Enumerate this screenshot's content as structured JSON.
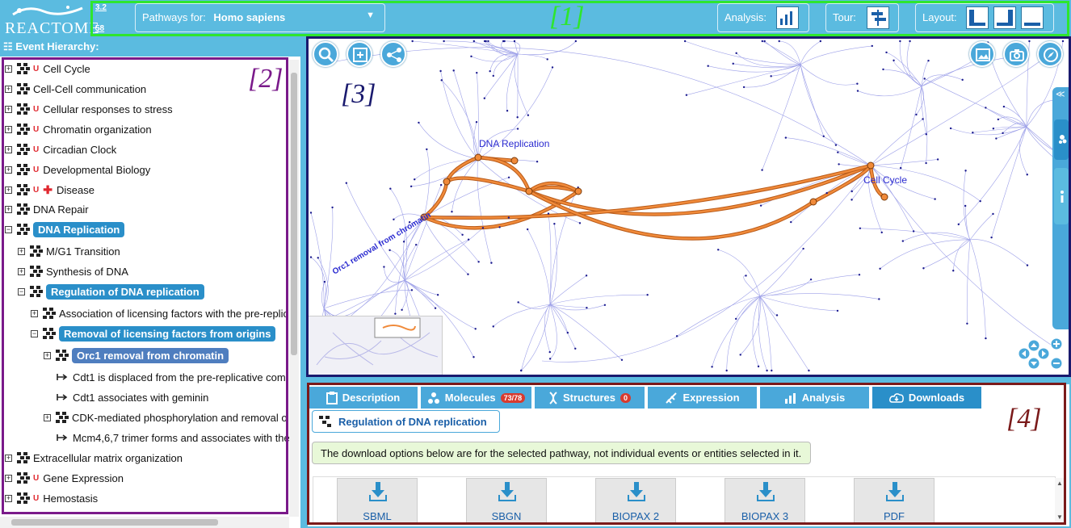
{
  "header": {
    "brand": "REACTOME",
    "version": "3.2",
    "db_version": "58",
    "species_prefix": "Pathways for:",
    "species": "Homo sapiens",
    "analysis_label": "Analysis:",
    "tour_label": "Tour:",
    "layout_label": "Layout:",
    "region_label": "[1]"
  },
  "hierarchy": {
    "title": "Event Hierarchy:",
    "region_label": "[2]",
    "items": [
      {
        "label": "Cell Cycle"
      },
      {
        "label": "Cell-Cell communication"
      },
      {
        "label": "Cellular responses to stress"
      },
      {
        "label": "Chromatin organization"
      },
      {
        "label": "Circadian Clock"
      },
      {
        "label": "Developmental Biology"
      },
      {
        "label": "Disease"
      },
      {
        "label": "DNA Repair"
      },
      {
        "label": "DNA Replication"
      },
      {
        "label": "M/G1 Transition"
      },
      {
        "label": "Synthesis of DNA"
      },
      {
        "label": "Regulation of DNA replication"
      },
      {
        "label": "Association of licensing factors with the pre-replic"
      },
      {
        "label": "Removal of licensing factors from origins"
      },
      {
        "label": "Orc1 removal from chromatin"
      },
      {
        "label": "Cdt1 is displaced from the pre-replicative com"
      },
      {
        "label": "Cdt1 associates with geminin"
      },
      {
        "label": "CDK-mediated phosphorylation and removal o"
      },
      {
        "label": "Mcm4,6,7 trimer forms and associates with the"
      },
      {
        "label": "Extracellular matrix organization"
      },
      {
        "label": "Gene Expression"
      },
      {
        "label": "Hemostasis"
      }
    ]
  },
  "diagram": {
    "region_label": "[3]",
    "labels": {
      "dna_replication": "DNA Replication",
      "cell_cycle": "Cell Cycle",
      "orc1": "Orc1 removal from chromatin"
    },
    "colors": {
      "highlight": "#f08a3a",
      "edge": "#9da0e8",
      "node": "#1a1a8e"
    }
  },
  "details": {
    "region_label": "[4]",
    "tabs": [
      {
        "label": "Description"
      },
      {
        "label": "Molecules",
        "count": "73/78"
      },
      {
        "label": "Structures",
        "count": "0"
      },
      {
        "label": "Expression"
      },
      {
        "label": "Analysis"
      },
      {
        "label": "Downloads"
      }
    ],
    "pathway_title": "Regulation of DNA replication",
    "note": "The download options below are for the selected pathway, not individual events or entities selected in it.",
    "downloads": [
      {
        "label": "SBML"
      },
      {
        "label": "SBGN"
      },
      {
        "label": "BIOPAX 2"
      },
      {
        "label": "BIOPAX 3"
      },
      {
        "label": "PDF"
      }
    ]
  }
}
